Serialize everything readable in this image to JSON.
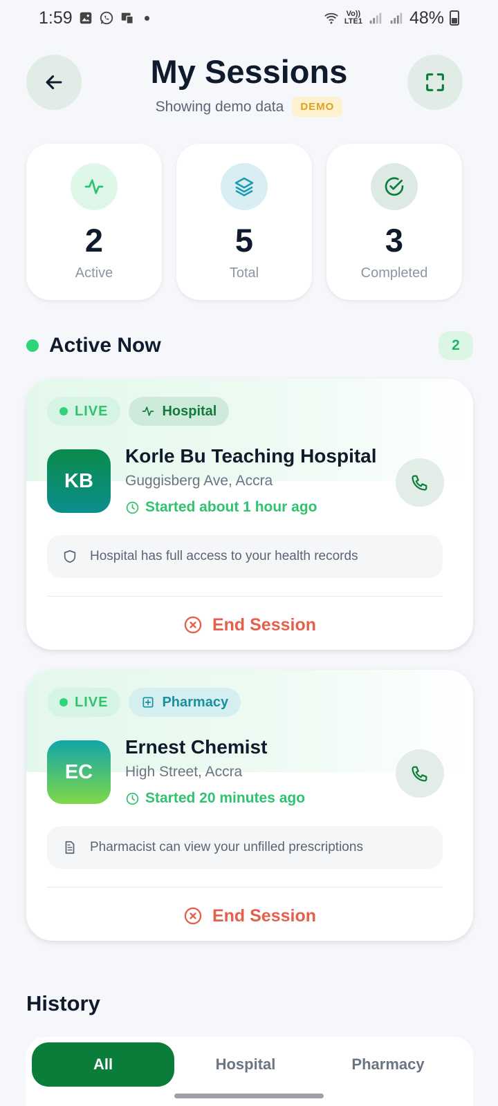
{
  "status_bar": {
    "time": "1:59",
    "network_top": "Vo))",
    "network_bottom": "LTE1",
    "battery": "48%"
  },
  "header": {
    "title": "My Sessions",
    "subtitle": "Showing demo data",
    "badge": "DEMO"
  },
  "stats": [
    {
      "value": "2",
      "label": "Active",
      "icon": "activity-icon"
    },
    {
      "value": "5",
      "label": "Total",
      "icon": "layers-icon"
    },
    {
      "value": "3",
      "label": "Completed",
      "icon": "check-circle-icon"
    }
  ],
  "active_section": {
    "title": "Active Now",
    "count": "2"
  },
  "sessions": [
    {
      "live_label": "LIVE",
      "type_label": "Hospital",
      "initials": "KB",
      "name": "Korle Bu Teaching Hospital",
      "address": "Guggisberg Ave, Accra",
      "started": "Started about 1 hour ago",
      "info": "Hospital has full access to your health records",
      "end_label": "End Session"
    },
    {
      "live_label": "LIVE",
      "type_label": "Pharmacy",
      "initials": "EC",
      "name": "Ernest Chemist",
      "address": "High Street, Accra",
      "started": "Started 20 minutes ago",
      "info": "Pharmacist can view your unfilled prescriptions",
      "end_label": "End Session"
    }
  ],
  "history": {
    "title": "History",
    "tabs": [
      {
        "label": "All",
        "selected": true
      },
      {
        "label": "Hospital",
        "selected": false
      },
      {
        "label": "Pharmacy",
        "selected": false
      }
    ]
  },
  "colors": {
    "primary": "#0a7d3a",
    "live_green": "#2fd37a",
    "danger": "#e5604a",
    "demo_badge": "#e0a11b"
  }
}
